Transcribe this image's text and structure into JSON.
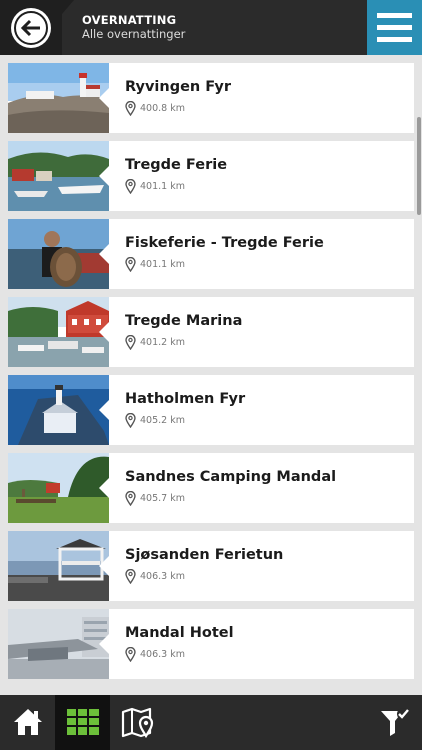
{
  "header": {
    "title": "OVERNATTING",
    "subtitle": "Alle overnattinger",
    "back_icon": "arrow-left-icon",
    "menu_icon": "hamburger-menu-icon",
    "colors": {
      "header_bg": "#2b2b2b",
      "menu_bg": "#2a8fb5"
    }
  },
  "items": [
    {
      "name": "Ryvingen Fyr",
      "distance": "400.8 km"
    },
    {
      "name": "Tregde Ferie",
      "distance": "401.1 km"
    },
    {
      "name": "Fiskeferie - Tregde Ferie",
      "distance": "401.1 km"
    },
    {
      "name": "Tregde Marina",
      "distance": "401.2 km"
    },
    {
      "name": "Hatholmen Fyr",
      "distance": "405.2 km"
    },
    {
      "name": "Sandnes Camping Mandal",
      "distance": "405.7 km"
    },
    {
      "name": "Sjøsanden Ferietun",
      "distance": "406.3 km"
    },
    {
      "name": "Mandal Hotel",
      "distance": "406.3 km"
    }
  ],
  "tabbar": {
    "tabs": [
      {
        "icon": "home-icon"
      },
      {
        "icon": "grid-list-icon",
        "active": true
      },
      {
        "icon": "map-pin-icon"
      },
      {
        "icon": "filter-icon"
      }
    ],
    "accent": "#6cbf3a"
  }
}
